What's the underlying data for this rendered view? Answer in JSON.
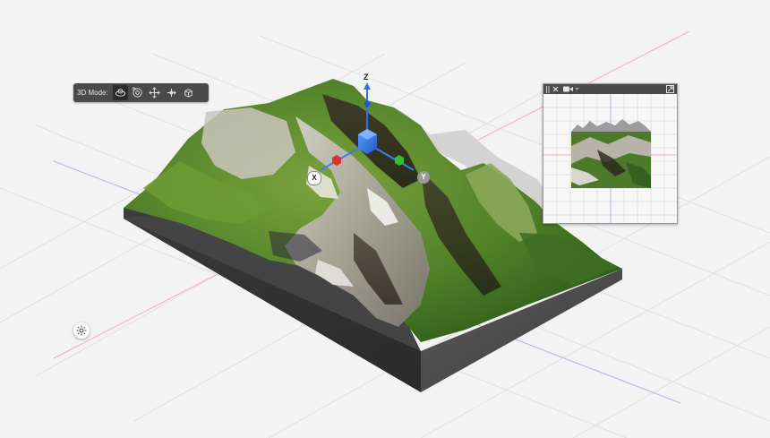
{
  "toolbar": {
    "label": "3D Mode:",
    "buttons": [
      {
        "name": "orbit-3d-camera",
        "icon": "orbit-icon",
        "active": true
      },
      {
        "name": "roll-3d-camera",
        "icon": "roll-icon",
        "active": false
      },
      {
        "name": "pan-3d-camera",
        "icon": "pan-icon",
        "active": false
      },
      {
        "name": "slide-3d-camera",
        "icon": "slide-icon",
        "active": false
      },
      {
        "name": "scale-3d-object",
        "icon": "scale-icon",
        "active": false
      }
    ]
  },
  "gizmo": {
    "z_label": "Z",
    "x_label": "X",
    "y_label": "Y",
    "colors": {
      "x": "#e0302a",
      "y": "#2fbf2f",
      "z": "#2f6ff0"
    }
  },
  "preview": {
    "icons": [
      "grip-icon",
      "close-icon",
      "camera-icon",
      "chevron-down-icon",
      "expand-icon"
    ]
  },
  "light_button": {
    "icon": "sun-icon"
  },
  "colors": {
    "background": "#f3f3f3",
    "toolbar": "#4a4a4a",
    "terrain_green": "#5b8a2e",
    "terrain_rock": "#b3b0a8",
    "base_side": "#4d4d4d"
  }
}
